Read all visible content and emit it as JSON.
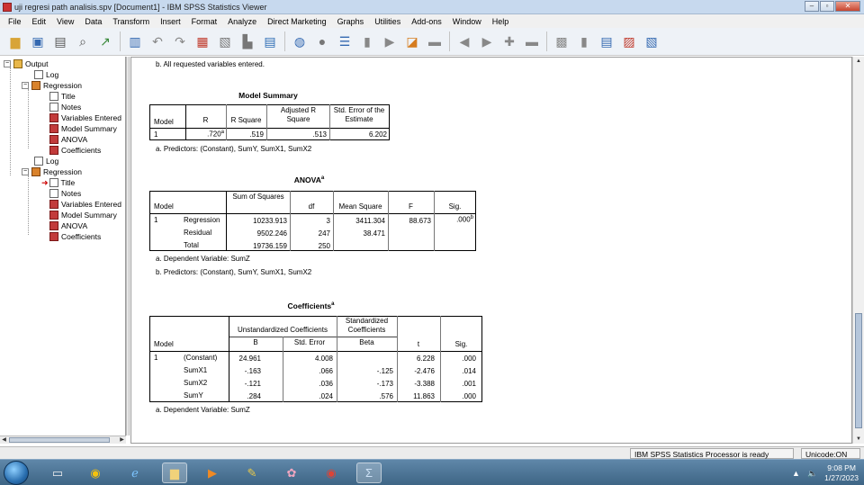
{
  "window": {
    "title": "uji regresi path analisis.spv [Document1] - IBM SPSS Statistics Viewer",
    "buttons": [
      "–",
      "▫",
      "✕"
    ]
  },
  "menu": [
    "File",
    "Edit",
    "View",
    "Data",
    "Transform",
    "Insert",
    "Format",
    "Analyze",
    "Direct Marketing",
    "Graphs",
    "Utilities",
    "Add-ons",
    "Window",
    "Help"
  ],
  "toolbar_icons": [
    "open-icon",
    "save-icon",
    "print-icon",
    "print-preview-icon",
    "export-icon",
    "recall-dialog-icon",
    "undo-icon",
    "redo-icon",
    "goto-data-icon",
    "goto-case-icon",
    "variables-icon",
    "pivot-icon",
    "show-icon",
    "hide-icon",
    "insert-output-icon",
    "promote-icon",
    "demote-icon",
    "expand-icon",
    "collapse-icon",
    "designate-window-icon",
    "insert-heading-icon",
    "insert-title-icon",
    "insert-text-icon",
    "insert-chart-icon"
  ],
  "outline": {
    "items": [
      {
        "label": "Output",
        "level": 0,
        "icon": "book"
      },
      {
        "label": "Log",
        "level": 1,
        "icon": "log"
      },
      {
        "label": "Regression",
        "level": 1,
        "icon": "reg"
      },
      {
        "label": "Title",
        "level": 2,
        "icon": "doc"
      },
      {
        "label": "Notes",
        "level": 2,
        "icon": "doc"
      },
      {
        "label": "Variables Entered",
        "level": 2,
        "icon": "red"
      },
      {
        "label": "Model Summary",
        "level": 2,
        "icon": "red"
      },
      {
        "label": "ANOVA",
        "level": 2,
        "icon": "red"
      },
      {
        "label": "Coefficients",
        "level": 2,
        "icon": "red"
      },
      {
        "label": "Log",
        "level": 1,
        "icon": "log"
      },
      {
        "label": "Regression",
        "level": 1,
        "icon": "reg"
      },
      {
        "label": "Title",
        "level": 2,
        "icon": "doc"
      },
      {
        "label": "Notes",
        "level": 2,
        "icon": "doc"
      },
      {
        "label": "Variables Entered",
        "level": 2,
        "icon": "red"
      },
      {
        "label": "Model Summary",
        "level": 2,
        "icon": "red"
      },
      {
        "label": "ANOVA",
        "level": 2,
        "icon": "red"
      },
      {
        "label": "Coefficients",
        "level": 2,
        "icon": "red"
      }
    ]
  },
  "content": {
    "top_note": "b. All requested variables entered.",
    "model_summary": {
      "title": "Model Summary",
      "headers": [
        "Model",
        "R",
        "R Square",
        "Adjusted R Square",
        "Std. Error of the Estimate"
      ],
      "row": {
        "model": "1",
        "r": ".720",
        "r_sup": "a",
        "r_square": ".519",
        "adj_r_square": ".513",
        "std_error": "6.202"
      },
      "footnote": "a. Predictors: (Constant), SumY, SumX1, SumX2"
    },
    "anova": {
      "title": "ANOVA",
      "title_sup": "a",
      "headers": [
        "Model",
        "Sum of Squares",
        "df",
        "Mean Square",
        "F",
        "Sig."
      ],
      "model": "1",
      "rows": [
        {
          "label": "Regression",
          "ss": "10233.913",
          "df": "3",
          "ms": "3411.304",
          "f": "88.673",
          "sig": ".000",
          "sig_sup": "b"
        },
        {
          "label": "Residual",
          "ss": "9502.246",
          "df": "247",
          "ms": "38.471",
          "f": "",
          "sig": "",
          "sig_sup": ""
        },
        {
          "label": "Total",
          "ss": "19736.159",
          "df": "250",
          "ms": "",
          "f": "",
          "sig": "",
          "sig_sup": ""
        }
      ],
      "footnote_a": "a. Dependent Variable: SumZ",
      "footnote_b": "b. Predictors: (Constant), SumY, SumX1, SumX2"
    },
    "coefficients": {
      "title": "Coefficients",
      "title_sup": "a",
      "group_unstd": "Unstandardized Coefficients",
      "group_std": "Standardized Coefficients",
      "headers": [
        "Model",
        "B",
        "Std. Error",
        "Beta",
        "t",
        "Sig."
      ],
      "model": "1",
      "rows": [
        {
          "label": "(Constant)",
          "b": "24.961",
          "se": "4.008",
          "beta": "",
          "t": "6.228",
          "sig": ".000"
        },
        {
          "label": "SumX1",
          "b": "-.163",
          "se": ".066",
          "beta": "-.125",
          "t": "-2.476",
          "sig": ".014"
        },
        {
          "label": "SumX2",
          "b": "-.121",
          "se": ".036",
          "beta": "-.173",
          "t": "-3.388",
          "sig": ".001"
        },
        {
          "label": "SumY",
          "b": ".284",
          "se": ".024",
          "beta": ".576",
          "t": "11.863",
          "sig": ".000"
        }
      ],
      "footnote": "a. Dependent Variable: SumZ"
    }
  },
  "status": {
    "processor": "IBM SPSS Statistics Processor is ready",
    "unicode": "Unicode:ON"
  },
  "taskbar": {
    "time": "9:08 PM",
    "date": "1/27/2023",
    "apps": [
      "explorer-icon",
      "chrome-icon",
      "ie-icon",
      "folder-icon",
      "media-player-icon",
      "paint-icon",
      "game-icon",
      "chrome-alt-icon",
      "spss-icon"
    ]
  }
}
